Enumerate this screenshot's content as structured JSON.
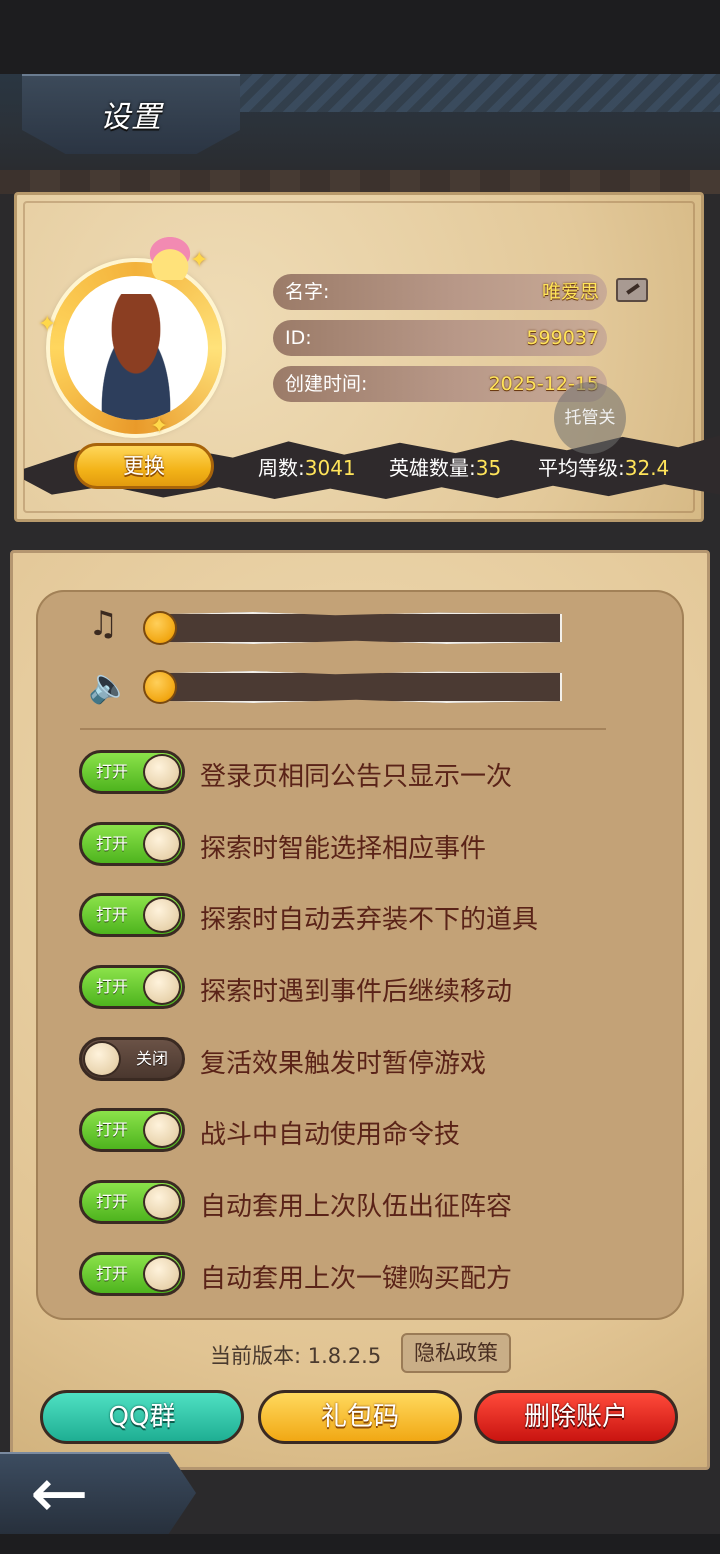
{
  "header": {
    "title": "设置"
  },
  "profile": {
    "name_label": "名字:",
    "name_value": "唯爱思",
    "id_label": "ID:",
    "id_value": "599037",
    "created_label": "创建时间:",
    "created_value": "2025-12-15",
    "tuoguan_label": "托管关",
    "change_button": "更换",
    "stats": [
      {
        "label": "周数:",
        "value": "3041"
      },
      {
        "label": "英雄数量:",
        "value": "35"
      },
      {
        "label": "平均等级:",
        "value": "32.4"
      }
    ]
  },
  "audio": {
    "music_icon": "music-note-icon",
    "sound_icon": "speaker-icon",
    "music_volume": 0,
    "sound_volume": 0
  },
  "options": [
    {
      "state": "打开",
      "on": true,
      "label": "登录页相同公告只显示一次"
    },
    {
      "state": "打开",
      "on": true,
      "label": "探索时智能选择相应事件"
    },
    {
      "state": "打开",
      "on": true,
      "label": "探索时自动丢弃装不下的道具"
    },
    {
      "state": "打开",
      "on": true,
      "label": "探索时遇到事件后继续移动"
    },
    {
      "state": "关闭",
      "on": false,
      "label": "复活效果触发时暂停游戏"
    },
    {
      "state": "打开",
      "on": true,
      "label": "战斗中自动使用命令技"
    },
    {
      "state": "打开",
      "on": true,
      "label": "自动套用上次队伍出征阵容"
    },
    {
      "state": "打开",
      "on": true,
      "label": "自动套用上次一键购买配方"
    }
  ],
  "footer": {
    "version_text": "当前版本: 1.8.2.5",
    "privacy_button": "隐私政策",
    "qq_button": "QQ群",
    "gift_button": "礼包码",
    "delete_button": "删除账户"
  },
  "colors": {
    "toggle_on": "#5cc62a",
    "toggle_off": "#4a372e",
    "value_yellow": "#ffe45a",
    "delete_red": "#d61a14",
    "qq_teal": "#2fc3a6",
    "gift_gold": "#f3b318"
  }
}
